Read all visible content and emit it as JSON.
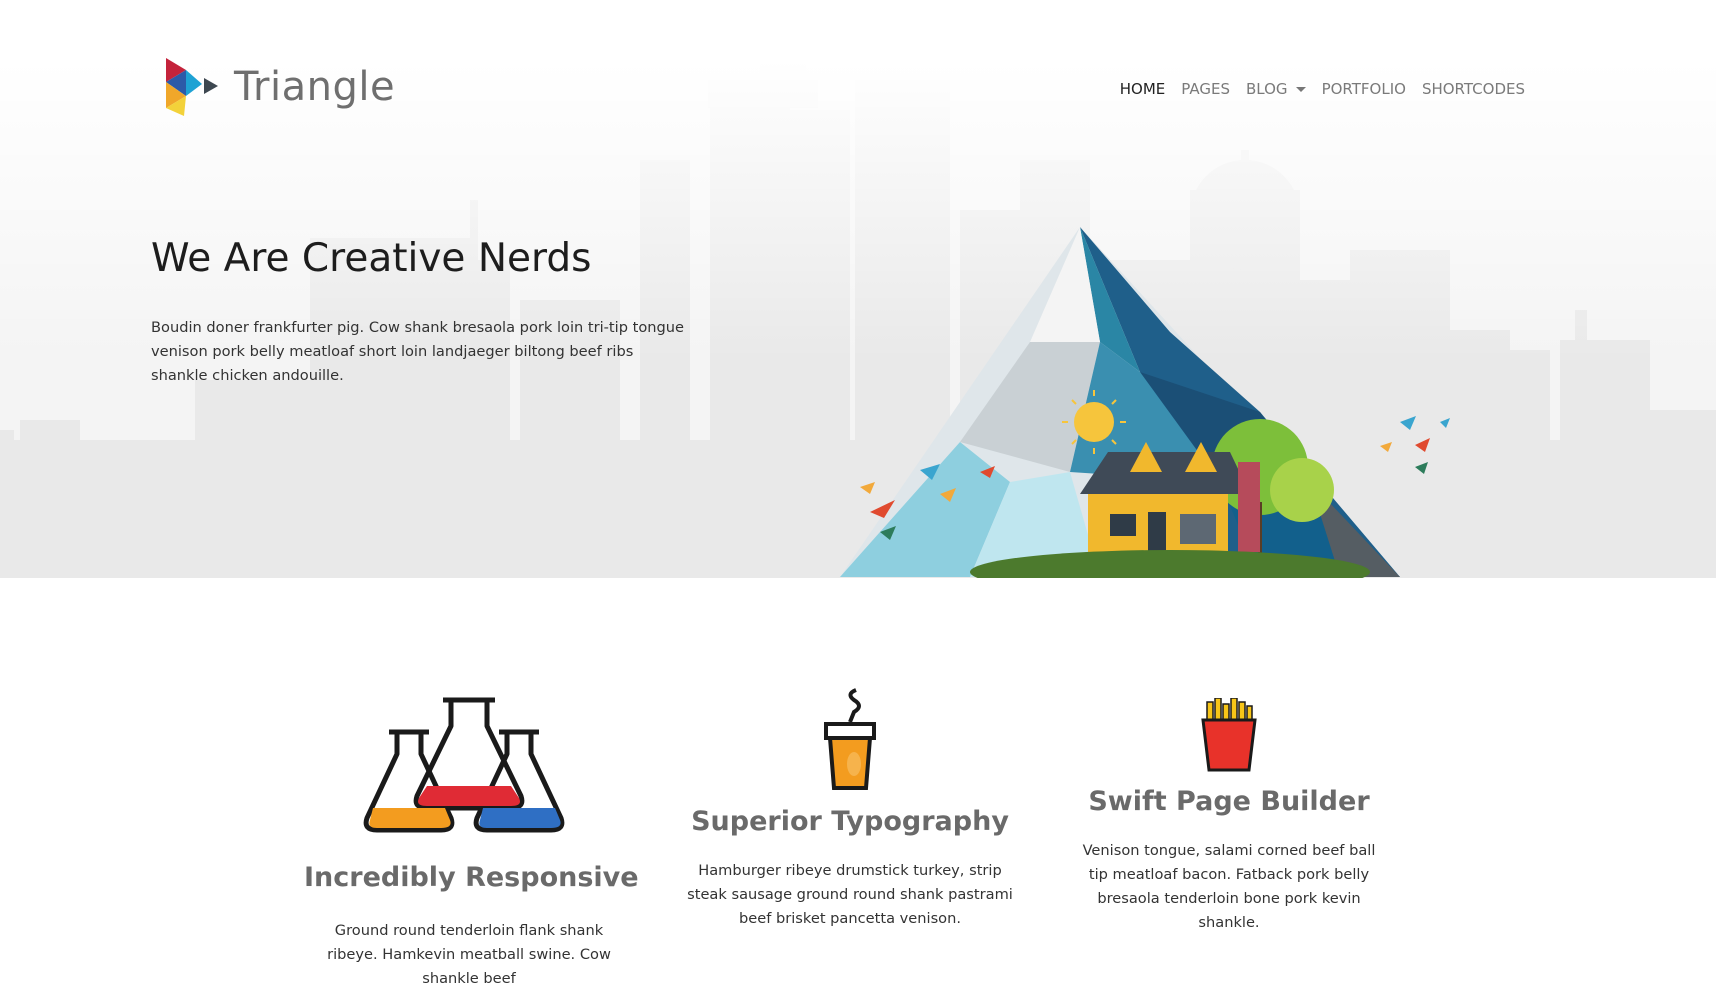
{
  "brand": {
    "name": "Triangle"
  },
  "nav": {
    "items": [
      {
        "label": "HOME",
        "active": true
      },
      {
        "label": "PAGES"
      },
      {
        "label": "BLOG",
        "dropdown": true
      },
      {
        "label": "PORTFOLIO"
      },
      {
        "label": "SHORTCODES"
      }
    ]
  },
  "hero": {
    "title": "We Are Creative Nerds",
    "text": "Boudin doner frankfurter pig. Cow shank bresaola pork loin tri-tip tongue venison pork belly meatloaf short loin landjaeger biltong beef ribs shankle chicken andouille."
  },
  "features": [
    {
      "icon": "flasks-icon",
      "title": "Incredibly Responsive",
      "text": "Ground round tenderloin flank shank ribeye. Hamkevin meatball swine. Cow shankle beef"
    },
    {
      "icon": "coffee-cup-icon",
      "title": "Superior Typography",
      "text": "Hamburger ribeye drumstick turkey, strip steak sausage ground round shank pastrami beef brisket pancetta venison."
    },
    {
      "icon": "fries-icon",
      "title": "Swift Page Builder",
      "text": "Venison tongue, salami corned beef ball tip meatloaf bacon. Fatback pork belly bresaola tenderloin bone pork kevin shankle."
    }
  ],
  "colors": {
    "background": "#ffffff",
    "hero_band": "#f4f4f4",
    "skyline": "#ececec",
    "heading": "#1d1d1d",
    "nav_active": "#222222",
    "nav": "#7a7a7a"
  }
}
